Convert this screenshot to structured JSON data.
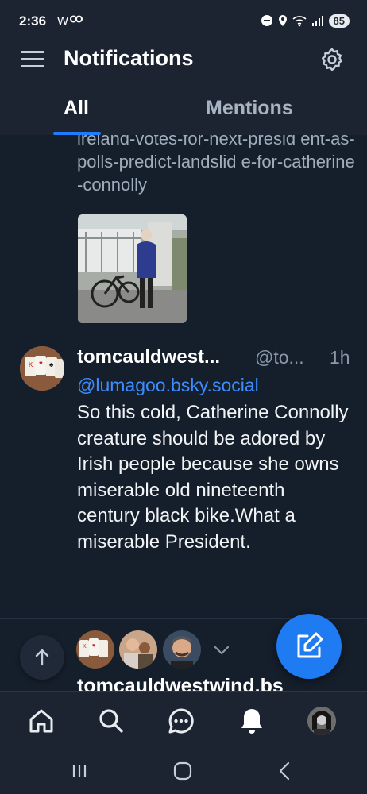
{
  "status_bar": {
    "time": "2:36",
    "app_indicator": "W",
    "battery": "85"
  },
  "header": {
    "title": "Notifications",
    "tabs": [
      {
        "label": "All",
        "selected": true
      },
      {
        "label": "Mentions",
        "selected": false
      }
    ]
  },
  "feed": {
    "link_post": {
      "link_text": "ireland-votes-for-next-presid ent-as-polls-predict-landslid e-for-catherine-connolly"
    },
    "reply_post": {
      "author": "tomcauldwest...",
      "handle": "@to...",
      "time": "1h",
      "mention": "@lumagoo.bsky.social",
      "text": "So this cold, Catherine Connolly creature should be adored by Irish people because she owns miserable old nineteenth century black bike.What a miserable President."
    },
    "notification": {
      "text": "tomcauldwestwind.bs"
    }
  },
  "colors": {
    "background": "#151e2b",
    "bar": "#1b2430",
    "accent": "#1e7bf2",
    "link": "#3d8dff",
    "muted": "#8a98a8"
  },
  "icons": {
    "menu": "hamburger-icon",
    "settings": "gear-icon",
    "reply": "speech-bubble-icon",
    "repost": "repost-icon",
    "like": "heart-icon",
    "bookmark": "bookmark-icon",
    "share": "share-icon",
    "more": "ellipsis-icon",
    "compose": "pencil-square-icon",
    "scroll_top": "arrow-up-icon",
    "home": "home-icon",
    "search": "search-icon",
    "chat": "chat-icon",
    "notifications": "bell-icon"
  }
}
